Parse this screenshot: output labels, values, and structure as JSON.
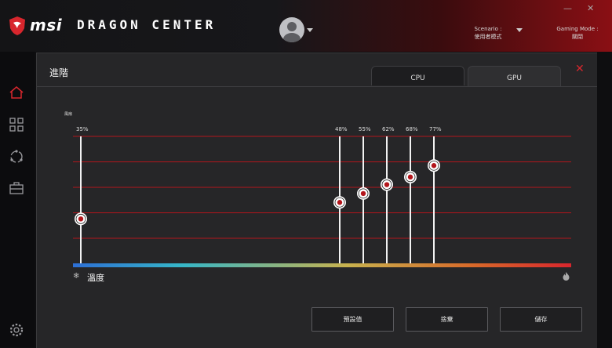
{
  "header": {
    "brand": "msi",
    "app_name": "DRAGON CENTER",
    "scenario_label": "Scenario :",
    "scenario_value": "使用者模式",
    "gaming_mode_label": "Gaming Mode :",
    "gaming_mode_value": "關閉",
    "minimize_glyph": "—",
    "close_glyph": "✕"
  },
  "sidebar": {
    "items": [
      {
        "icon": "home-icon",
        "active": true
      },
      {
        "icon": "grid-icon",
        "active": false
      },
      {
        "icon": "sync-icon",
        "active": false
      },
      {
        "icon": "toolbox-icon",
        "active": false
      },
      {
        "icon": "gear-icon",
        "active": false
      }
    ]
  },
  "dialog": {
    "title": "進階",
    "close_glyph": "✕",
    "tabs": [
      {
        "label": "CPU",
        "active": false
      },
      {
        "label": "GPU",
        "active": true
      }
    ],
    "y_label": "風扇",
    "x_label": "溫度",
    "buttons": {
      "default": "預設值",
      "discard": "捨棄",
      "save": "儲存"
    }
  },
  "colors": {
    "accent": "#d8262d",
    "grid_line": "#b3151b",
    "background": "#262628"
  },
  "chart_data": {
    "type": "line",
    "x_axis_gradient": [
      "#2d6fd6",
      "#36b7c8",
      "#c8b24e",
      "#d86a2a",
      "#d8262d"
    ],
    "points": [
      {
        "label": "35%",
        "y": 35,
        "x_frac": 0.0
      },
      {
        "label": "48%",
        "y": 48,
        "x_frac": 0.0
      },
      {
        "label": "55%",
        "y": 55,
        "x_frac": 0.0
      },
      {
        "label": "62%",
        "y": 62,
        "x_frac": 0.0
      },
      {
        "label": "68%",
        "y": 68,
        "x_frac": 0.0
      },
      {
        "label": "77%",
        "y": 77,
        "x_frac": 0.0
      }
    ],
    "ylim": [
      0,
      100
    ],
    "grid": true
  }
}
